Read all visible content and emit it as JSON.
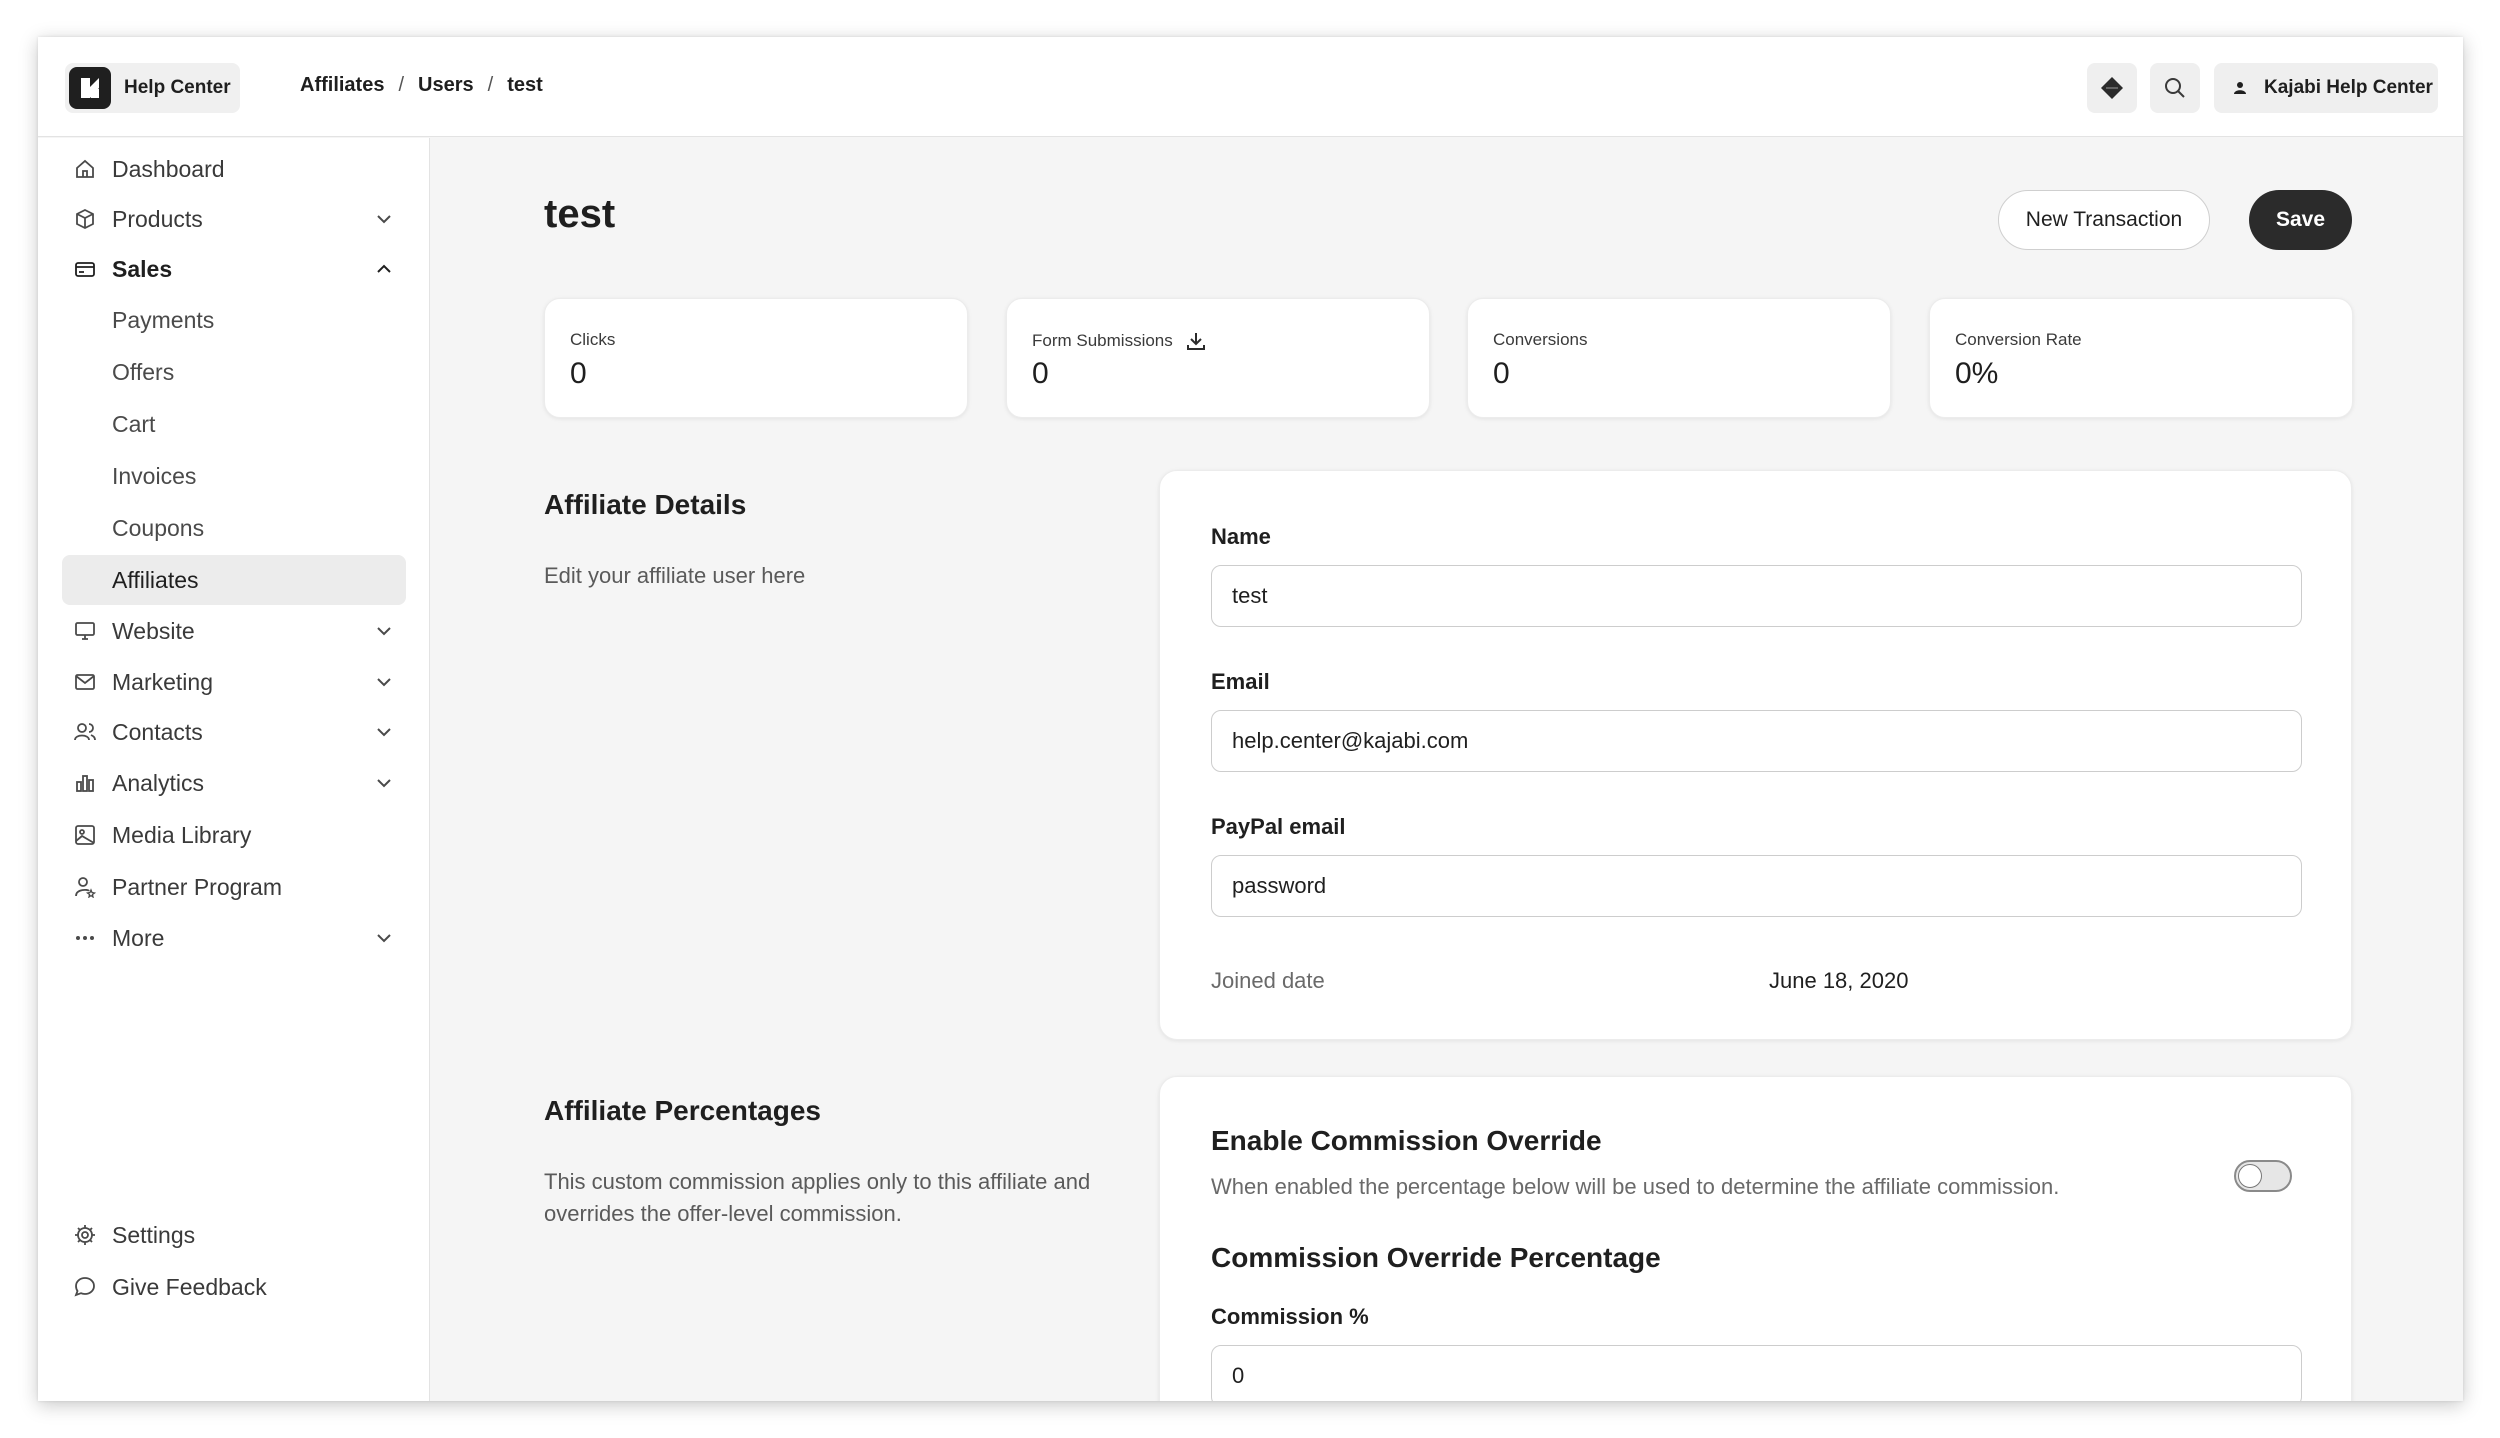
{
  "brand": {
    "name": "Help Center"
  },
  "breadcrumb": [
    "Affiliates",
    "Users",
    "test"
  ],
  "account": {
    "name": "Kajabi Help Center"
  },
  "sidebar": {
    "items": [
      {
        "label": "Dashboard",
        "icon": "home-icon"
      },
      {
        "label": "Products",
        "icon": "box-icon"
      },
      {
        "label": "Sales",
        "icon": "card-icon"
      },
      {
        "label": "Website",
        "icon": "monitor-icon"
      },
      {
        "label": "Marketing",
        "icon": "mail-icon"
      },
      {
        "label": "Contacts",
        "icon": "users-icon"
      },
      {
        "label": "Analytics",
        "icon": "bar-chart-icon"
      },
      {
        "label": "Media Library",
        "icon": "image-icon"
      },
      {
        "label": "Partner Program",
        "icon": "person-star-icon"
      },
      {
        "label": "More",
        "icon": "dots-icon"
      }
    ],
    "sales_sub": [
      "Payments",
      "Offers",
      "Cart",
      "Invoices",
      "Coupons",
      "Affiliates"
    ],
    "footer": [
      {
        "label": "Settings",
        "icon": "gear-icon"
      },
      {
        "label": "Give Feedback",
        "icon": "chat-icon"
      }
    ]
  },
  "page": {
    "title": "test",
    "new_transaction_label": "New Transaction",
    "save_label": "Save"
  },
  "stats": [
    {
      "label": "Clicks",
      "value": "0"
    },
    {
      "label": "Form Submissions",
      "value": "0"
    },
    {
      "label": "Conversions",
      "value": "0"
    },
    {
      "label": "Conversion Rate",
      "value": "0%"
    }
  ],
  "details": {
    "title": "Affiliate Details",
    "description": "Edit your affiliate user here",
    "name_label": "Name",
    "name_value": "test",
    "email_label": "Email",
    "email_value": "help.center@kajabi.com",
    "paypal_label": "PayPal email",
    "paypal_value": "password",
    "joined_label": "Joined date",
    "joined_value": "June 18, 2020"
  },
  "percentages": {
    "title": "Affiliate Percentages",
    "description": "This custom commission applies only to this affiliate and overrides the offer-level commission.",
    "override_title": "Enable Commission Override",
    "override_desc": "When enabled the percentage below will be used to determine the affiliate commission.",
    "override_enabled": false,
    "percent_title": "Commission Override Percentage",
    "commission_label": "Commission %",
    "commission_value": "0"
  }
}
